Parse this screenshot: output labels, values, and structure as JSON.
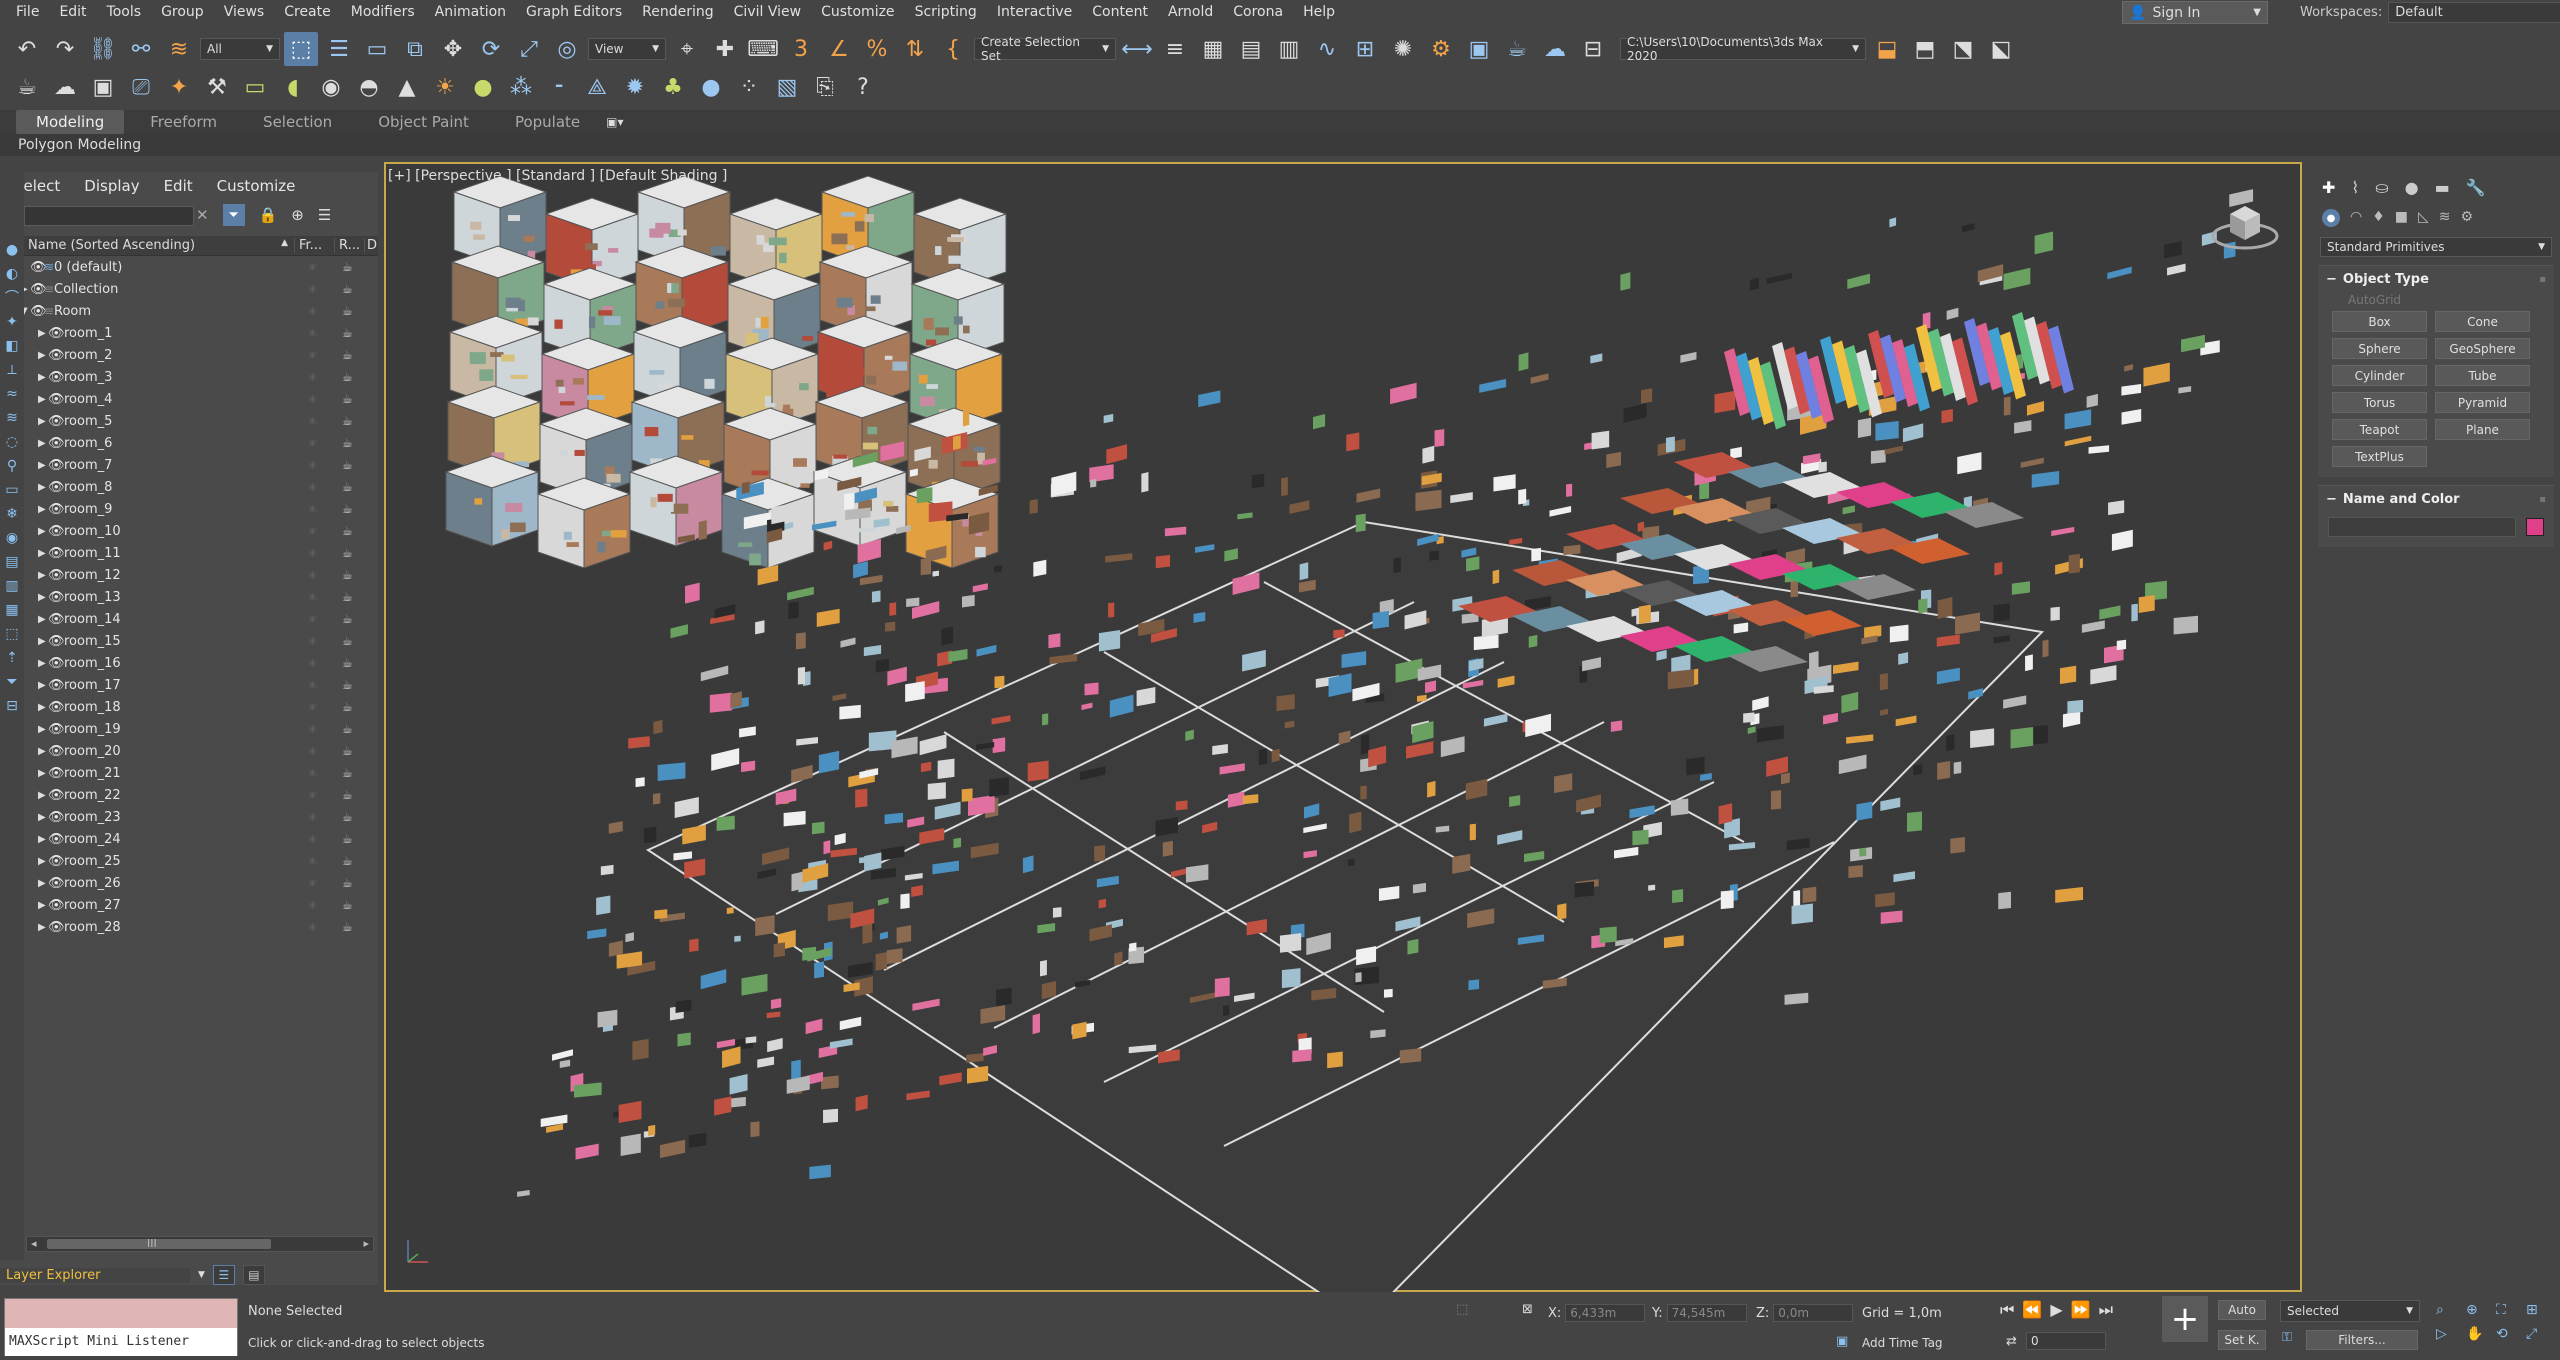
{
  "menu": [
    "File",
    "Edit",
    "Tools",
    "Group",
    "Views",
    "Create",
    "Modifiers",
    "Animation",
    "Graph Editors",
    "Rendering",
    "Civil View",
    "Customize",
    "Scripting",
    "Interactive",
    "Content",
    "Arnold",
    "Corona",
    "Help"
  ],
  "signin": {
    "label": "Sign In"
  },
  "workspaces": {
    "label": "Workspaces:",
    "value": "Default"
  },
  "toolbar": {
    "filter_value": "All",
    "refcoord_value": "View",
    "selection_set_placeholder": "Create Selection Set",
    "project_path": "C:\\Users\\10\\Documents\\3ds Max 2020"
  },
  "ribbon": {
    "tabs": [
      "Modeling",
      "Freeform",
      "Selection",
      "Object Paint",
      "Populate"
    ],
    "sub_label": "Polygon Modeling"
  },
  "explorer": {
    "menu": [
      "Select",
      "Display",
      "Edit",
      "Customize"
    ],
    "col_name": "Name (Sorted Ascending)",
    "col_freeze": "Fr...",
    "col_render": "R...",
    "col_d": "D",
    "rows": [
      {
        "label": "0 (default)",
        "level": 0,
        "type": "layer"
      },
      {
        "label": "Collection",
        "level": 0,
        "type": "collapsed"
      },
      {
        "label": "Room",
        "level": 0,
        "type": "expanded"
      },
      {
        "label": "room_1",
        "level": 1
      },
      {
        "label": "room_2",
        "level": 1
      },
      {
        "label": "room_3",
        "level": 1
      },
      {
        "label": "room_4",
        "level": 1
      },
      {
        "label": "room_5",
        "level": 1
      },
      {
        "label": "room_6",
        "level": 1
      },
      {
        "label": "room_7",
        "level": 1
      },
      {
        "label": "room_8",
        "level": 1
      },
      {
        "label": "room_9",
        "level": 1
      },
      {
        "label": "room_10",
        "level": 1
      },
      {
        "label": "room_11",
        "level": 1
      },
      {
        "label": "room_12",
        "level": 1
      },
      {
        "label": "room_13",
        "level": 1
      },
      {
        "label": "room_14",
        "level": 1
      },
      {
        "label": "room_15",
        "level": 1
      },
      {
        "label": "room_16",
        "level": 1
      },
      {
        "label": "room_17",
        "level": 1
      },
      {
        "label": "room_18",
        "level": 1
      },
      {
        "label": "room_19",
        "level": 1
      },
      {
        "label": "room_20",
        "level": 1
      },
      {
        "label": "room_21",
        "level": 1
      },
      {
        "label": "room_22",
        "level": 1
      },
      {
        "label": "room_23",
        "level": 1
      },
      {
        "label": "room_24",
        "level": 1
      },
      {
        "label": "room_25",
        "level": 1
      },
      {
        "label": "room_26",
        "level": 1
      },
      {
        "label": "room_27",
        "level": 1
      },
      {
        "label": "room_28",
        "level": 1
      }
    ],
    "scroll_mark": "III",
    "layer_label": "Layer Explorer"
  },
  "viewport": {
    "label": "[+] [Perspective ] [Standard ] [Default Shading ]"
  },
  "command_panel": {
    "category": "Standard Primitives",
    "object_type_title": "Object Type",
    "autogrid": "AutoGrid",
    "buttons": [
      "Box",
      "Cone",
      "Sphere",
      "GeoSphere",
      "Cylinder",
      "Tube",
      "Torus",
      "Pyramid",
      "Teapot",
      "Plane",
      "TextPlus"
    ],
    "name_color_title": "Name and Color",
    "object_color": "#e0408a"
  },
  "status": {
    "maxscript": "MAXScript Mini Listener",
    "selected": "None Selected",
    "prompt": "Click or click-and-drag to select objects",
    "x_label": "X:",
    "x_value": "6,433m",
    "y_label": "Y:",
    "y_value": "74,545m",
    "z_label": "Z:",
    "z_value": "0,0m",
    "grid": "Grid = 1,0m",
    "add_time_tag": "Add Time Tag",
    "auto": "Auto",
    "selected_dropdown": "Selected",
    "setk": "Set K.",
    "filters": "Filters...",
    "frame": "0"
  }
}
